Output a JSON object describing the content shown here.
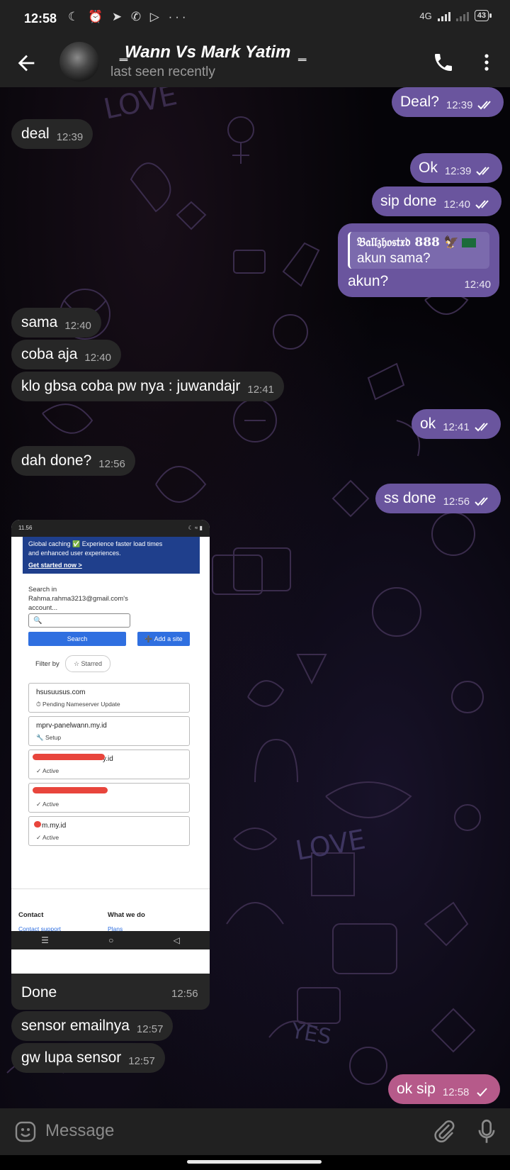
{
  "status_bar": {
    "time": "12:58",
    "left_icons": "☾ ⏰ ➤ ✆ ▷ ···",
    "network": "4G",
    "battery": "43"
  },
  "header": {
    "title": "ຏ͇Wann Vs Mark Yatimຏ͇",
    "subtitle": "last seen recently",
    "icons": [
      "back-arrow-icon",
      "phone-icon",
      "more-vert-icon"
    ]
  },
  "messages": [
    {
      "dir": "out",
      "text": "Deal?",
      "time": "12:39",
      "read": true
    },
    {
      "dir": "in",
      "text": "deal",
      "time": "12:39"
    },
    {
      "dir": "out",
      "text": "Ok",
      "time": "12:39",
      "read": true
    },
    {
      "dir": "out",
      "text": "sip done",
      "time": "12:40",
      "read": true
    },
    {
      "dir": "out",
      "reply_to_name": "𝔅𝔞𝔩𝔩𝔷𝔥𝔬𝔰𝔱𝔵𝔡 888 🦅",
      "reply_to_text": "akun sama?",
      "text": "akun?",
      "time": "12:40",
      "read": true
    },
    {
      "dir": "in",
      "text": "sama",
      "time": "12:40"
    },
    {
      "dir": "in",
      "text": "coba aja",
      "time": "12:40"
    },
    {
      "dir": "in",
      "text": "klo gbsa coba pw nya : juwandajr",
      "time": "12:41"
    },
    {
      "dir": "out",
      "text": "ok",
      "time": "12:41",
      "read": true
    },
    {
      "dir": "in",
      "text": "dah done?",
      "time": "12:56"
    },
    {
      "dir": "out",
      "text": "ss done",
      "time": "12:56",
      "read": true
    },
    {
      "dir": "in",
      "text": "Done",
      "time": "12:56"
    },
    {
      "dir": "in",
      "text": "sensor emailnya",
      "time": "12:57"
    },
    {
      "dir": "in",
      "text": "gw lupa sensor",
      "time": "12:57"
    },
    {
      "dir": "out",
      "text": "ok sip",
      "time": "12:58",
      "read": false
    }
  ],
  "screenshot": {
    "status_time": "11.56",
    "banner_line1": "Global caching ✅ Experience faster load times",
    "banner_line2": "and enhanced user experiences.",
    "banner_link": "Get started now >",
    "search_label": "Search in Rahma.rahma3213@gmail.com's account...",
    "search_placeholder": "🔍",
    "search_button": "Search",
    "add_site_button": "➕ Add a site",
    "filter_label": "Filter by",
    "starred": "☆ Starred",
    "sites": [
      {
        "domain": "hsusuusus.com",
        "status": "⏱ Pending Nameserver Update"
      },
      {
        "domain": "mprv-panelwann.my.id",
        "status": "🔧 Setup"
      },
      {
        "domain": "y.id",
        "status": "✓ Active"
      },
      {
        "domain": "",
        "status": "✓ Active"
      },
      {
        "domain": "m.my.id",
        "status": "✓ Active"
      }
    ],
    "footer_contact": "Contact",
    "footer_whatwedo": "What we do",
    "footer_contact_link": "Contact support",
    "footer_plans": "Plans",
    "nav_glyphs": [
      "☰",
      "○",
      "◁"
    ]
  },
  "composer": {
    "placeholder": "Message",
    "icons": [
      "emoji-icon",
      "attach-icon",
      "mic-icon"
    ]
  },
  "colors": {
    "outgoing_bubble": "#6a559e",
    "incoming_bubble": "#272727",
    "pending_bubble": "#b65a8a",
    "bars": "#212121"
  }
}
